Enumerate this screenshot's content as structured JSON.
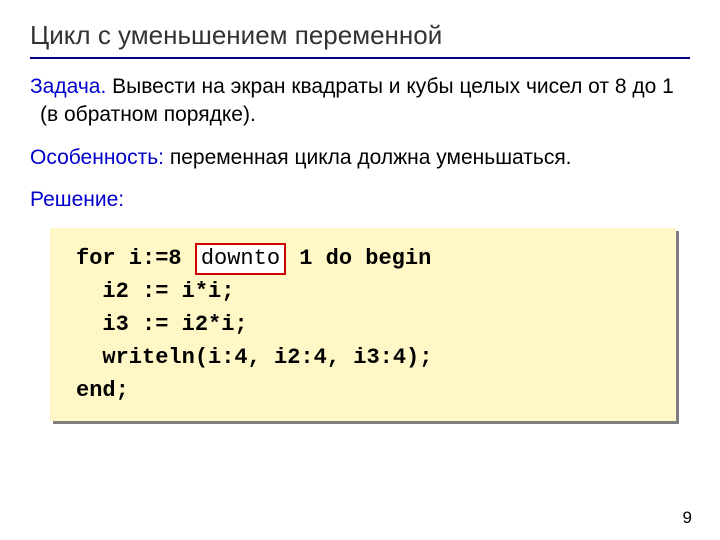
{
  "title": "Цикл с уменьшением переменной",
  "task": {
    "label": "Задача.",
    "text": " Вывести на экран квадраты и кубы целых чисел от 8 до 1 (в обратном порядке)."
  },
  "feature": {
    "label": "Особенность:",
    "text": " переменная цикла должна уменьшаться."
  },
  "solution_label": "Решение:",
  "code": {
    "l1a": "for i:=8 ",
    "l1_kw": "downto",
    "l1b": " 1 do begin",
    "l2": "  i2 := i*i;",
    "l3": "  i3 := i2*i;",
    "l4": "  writeln(i:4, i2:4, i3:4);",
    "l5": "end;"
  },
  "page_number": "9"
}
